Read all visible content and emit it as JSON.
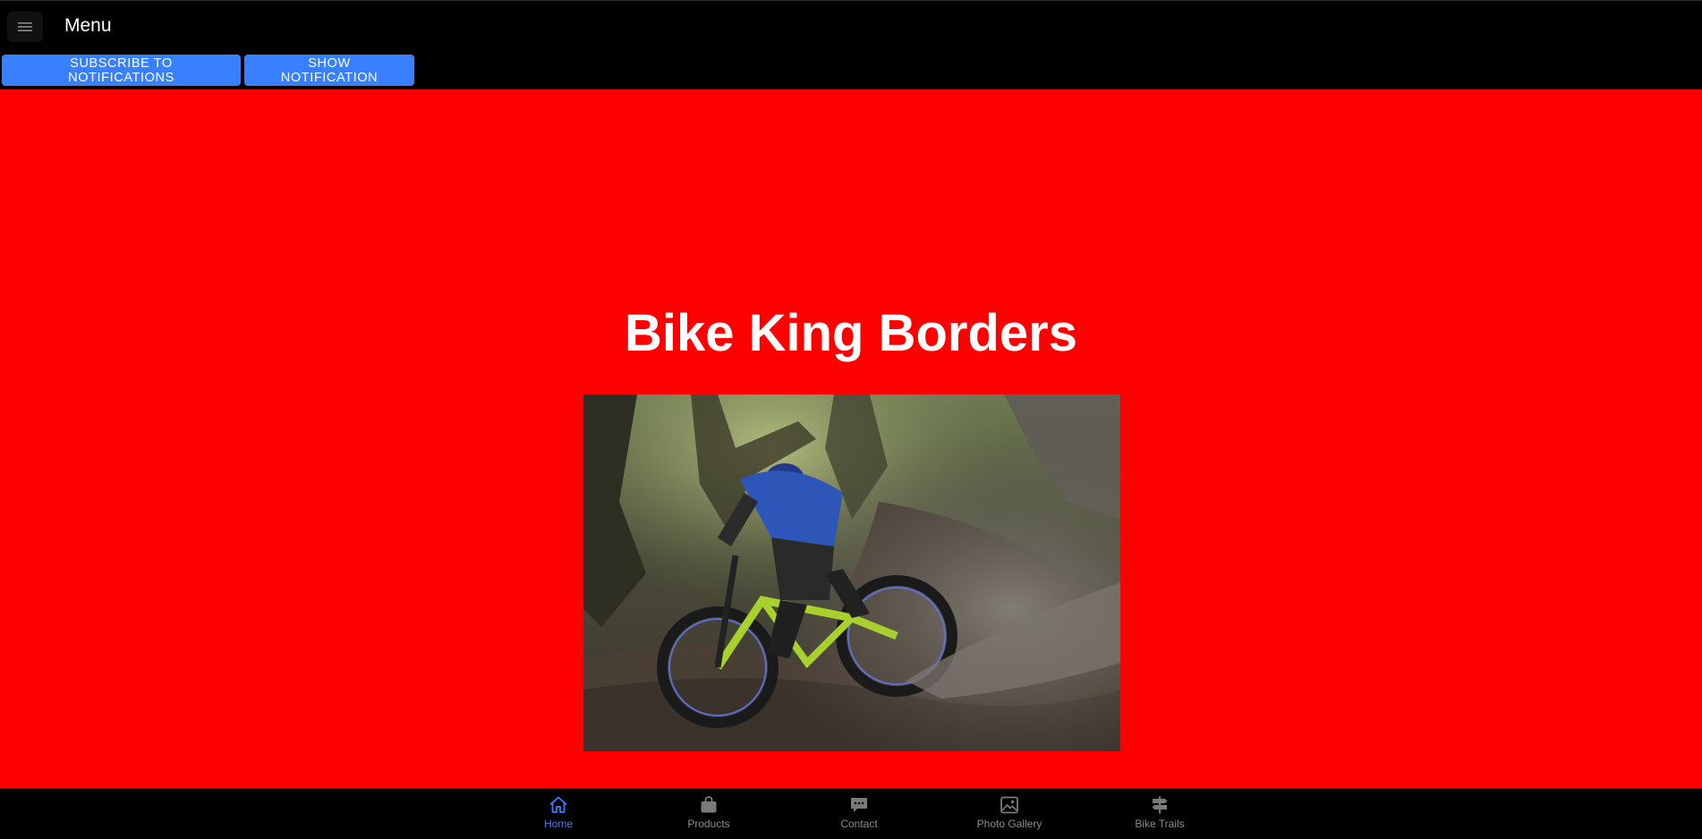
{
  "header": {
    "menu_icon": "menu-icon",
    "title": "Menu"
  },
  "actions": {
    "subscribe_label": "SUBSCRIBE TO NOTIFICATIONS",
    "show_label": "SHOW NOTIFICATION"
  },
  "hero": {
    "title": "Bike King Borders"
  },
  "tabs": [
    {
      "label": "Home",
      "icon": "home-icon",
      "active": true
    },
    {
      "label": "Products",
      "icon": "bag-icon",
      "active": false
    },
    {
      "label": "Contact",
      "icon": "chat-icon",
      "active": false
    },
    {
      "label": "Photo Gallery",
      "icon": "image-icon",
      "active": false
    },
    {
      "label": "Bike Trails",
      "icon": "signpost-icon",
      "active": false
    }
  ],
  "colors": {
    "accent": "#3880ff",
    "background": "#ff0000",
    "toolbar": "#000000",
    "inactive_tab": "#8c8c8c"
  }
}
